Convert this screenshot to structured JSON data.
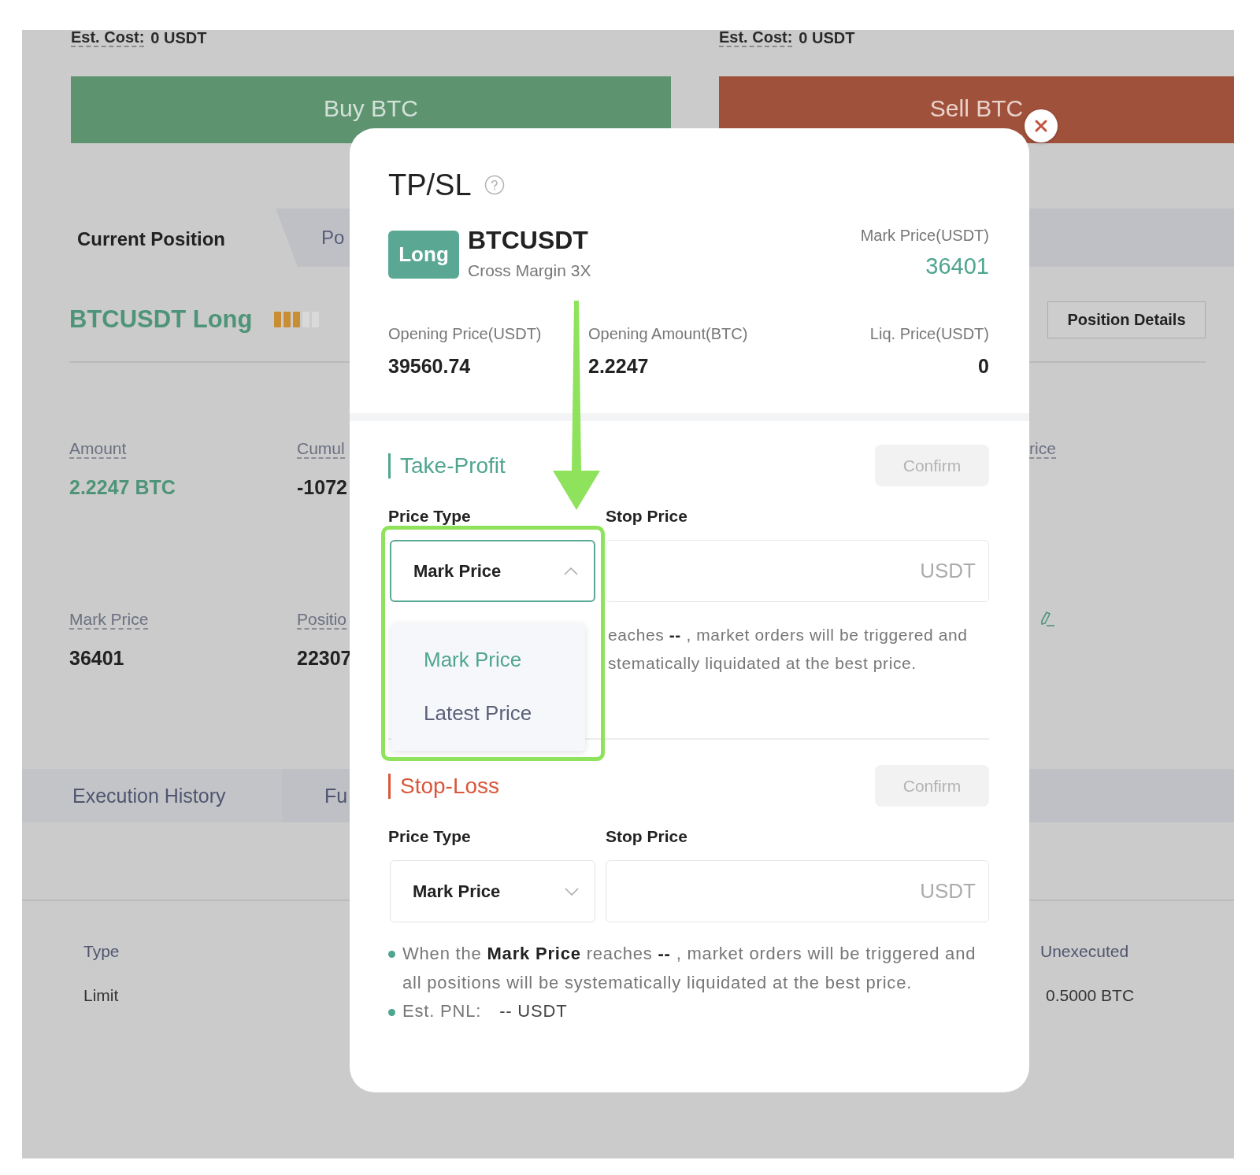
{
  "background": {
    "est_costs": [
      {
        "label": "Est. Cost:",
        "value": "0 USDT"
      },
      {
        "label": "Est. Cost:",
        "value": "0 USDT"
      }
    ],
    "trade_buttons": [
      {
        "kind": "buy",
        "label": "Buy BTC"
      },
      {
        "kind": "sell",
        "label": "Sell BTC"
      }
    ],
    "position_tabs": [
      {
        "label": "Current Position",
        "selected": true
      },
      {
        "label": "Po",
        "selected": false
      }
    ],
    "position": {
      "title": "BTCUSDT Long",
      "details_button": "Position Details"
    },
    "stats": [
      {
        "kind": "field",
        "label": "Amount",
        "value": "2.2247 BTC",
        "accent": true
      },
      {
        "kind": "field",
        "label": "Cumul",
        "value": "-1072",
        "accent": false
      },
      {
        "kind": "field",
        "label": "rice"
      },
      {
        "kind": "field",
        "label": "Mark Price",
        "value": "36401",
        "accent": false
      },
      {
        "kind": "field",
        "label": "Positio",
        "value": "22307",
        "accent": false
      },
      {
        "kind": "edit"
      }
    ],
    "history_tabs": [
      {
        "label": "Execution History",
        "selected": true
      },
      {
        "label": "Fu",
        "selected": false
      }
    ],
    "orders": {
      "columns": [
        "Type",
        "Unexecuted"
      ],
      "rows": [
        [
          "Limit",
          "0.5000 BTC"
        ]
      ]
    }
  },
  "modal": {
    "title": "TP/SL",
    "symbol": {
      "side": "Long",
      "name": "BTCUSDT",
      "margin": "Cross Margin 3X"
    },
    "mark_price": {
      "label": "Mark Price(USDT)",
      "value": "36401"
    },
    "stats": [
      {
        "label": "Opening Price(USDT)",
        "value": "39560.74"
      },
      {
        "label": "Opening Amount(BTC)",
        "value": "2.2247"
      },
      {
        "label": "Liq. Price(USDT)",
        "value": "0"
      }
    ],
    "sections": [
      {
        "kind": "take_profit",
        "title": "Take-Profit",
        "confirm": {
          "label": "Confirm",
          "disabled": true
        },
        "price_type": {
          "label": "Price Type",
          "value": "Mark Price",
          "expanded": true,
          "options": [
            {
              "label": "Mark Price",
              "selected": true
            },
            {
              "label": "Latest Price",
              "selected": false
            }
          ]
        },
        "stop_price": {
          "label": "Stop Price",
          "unit": "USDT"
        },
        "notice_fragment": [
          "eaches **--** , market orders will be triggered and",
          "stematically liquidated at the best price."
        ]
      },
      {
        "kind": "stop_loss",
        "title": "Stop-Loss",
        "confirm": {
          "label": "Confirm",
          "disabled": true
        },
        "price_type": {
          "label": "Price Type",
          "value": "Mark Price",
          "expanded": false
        },
        "stop_price": {
          "label": "Stop Price",
          "unit": "USDT"
        },
        "notes": [
          {
            "kind": "text",
            "text": "When the **Mark Price** reaches **--** , market orders will be triggered and all positions will be systematically liquidated at the best price."
          },
          {
            "kind": "pnl",
            "label": "Est. PNL:",
            "value": "-- USDT"
          }
        ]
      }
    ]
  }
}
